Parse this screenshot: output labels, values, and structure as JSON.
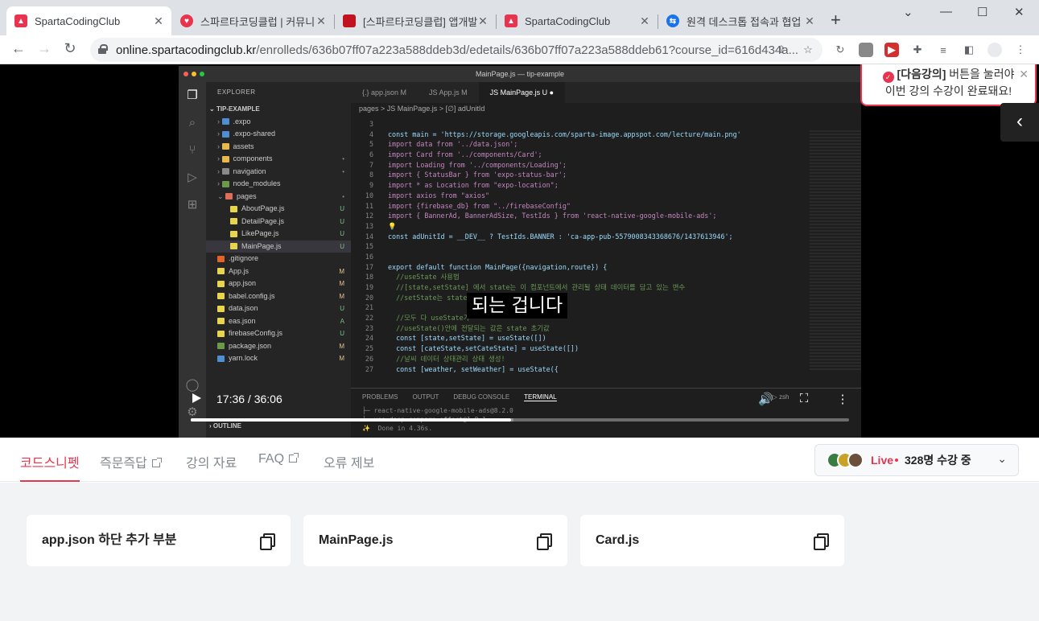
{
  "browser": {
    "tabs": [
      {
        "title": "SpartaCodingClub",
        "fav": "#e8344e"
      },
      {
        "title": "스파르타코딩클럽 | 커뮤니",
        "fav": "#e8344e"
      },
      {
        "title": "[스파르타코딩클럽] 앱개발",
        "fav": "#c1121f"
      },
      {
        "title": "SpartaCodingClub",
        "fav": "#e8344e"
      },
      {
        "title": "원격 데스크톱 접속과 협업",
        "fav": "#1a73e8"
      }
    ],
    "url_host": "online.spartacodingclub.kr",
    "url_path": "/enrolleds/636b07ff07a223a588ddeb3d/edetails/636b07ff07a223a588ddeb61?course_id=616d434a..."
  },
  "vscode": {
    "window_title": "MainPage.js — tip-example",
    "explorer_title": "EXPLORER",
    "project": "TIP-EXAMPLE",
    "files": [
      {
        "name": ".expo",
        "indent": 1,
        "color": "#4e8fd1",
        "status": ""
      },
      {
        "name": ".expo-shared",
        "indent": 1,
        "color": "#4e8fd1",
        "status": ""
      },
      {
        "name": "assets",
        "indent": 1,
        "color": "#e8b84a",
        "status": ""
      },
      {
        "name": "components",
        "indent": 1,
        "color": "#e8b84a",
        "status": "•"
      },
      {
        "name": "navigation",
        "indent": 1,
        "color": "#8a8a8a",
        "status": "•"
      },
      {
        "name": "node_modules",
        "indent": 1,
        "color": "#6a9a4a",
        "status": ""
      },
      {
        "name": "pages",
        "indent": 1,
        "color": "#e06c5a",
        "status": "•"
      },
      {
        "name": "AboutPage.js",
        "indent": 2,
        "color": "#e8d44d",
        "status": "U"
      },
      {
        "name": "DetailPage.js",
        "indent": 2,
        "color": "#e8d44d",
        "status": "U"
      },
      {
        "name": "LikePage.js",
        "indent": 2,
        "color": "#e8d44d",
        "status": "U"
      },
      {
        "name": "MainPage.js",
        "indent": 2,
        "color": "#e8d44d",
        "status": "U"
      },
      {
        "name": ".gitignore",
        "indent": 1,
        "color": "#e0642c",
        "status": ""
      },
      {
        "name": "App.js",
        "indent": 1,
        "color": "#e8d44d",
        "status": "M"
      },
      {
        "name": "app.json",
        "indent": 1,
        "color": "#e8d44d",
        "status": "M"
      },
      {
        "name": "babel.config.js",
        "indent": 1,
        "color": "#e8d44d",
        "status": "M"
      },
      {
        "name": "data.json",
        "indent": 1,
        "color": "#e8d44d",
        "status": "U"
      },
      {
        "name": "eas.json",
        "indent": 1,
        "color": "#e8d44d",
        "status": "A"
      },
      {
        "name": "firebaseConfig.js",
        "indent": 1,
        "color": "#e8d44d",
        "status": "U"
      },
      {
        "name": "package.json",
        "indent": 1,
        "color": "#6a9a4a",
        "status": "M"
      },
      {
        "name": "yarn.lock",
        "indent": 1,
        "color": "#4e8fd1",
        "status": "M"
      }
    ],
    "outline": "OUTLINE",
    "editor_tabs": [
      "{.} app.json M",
      "JS App.js M",
      "JS MainPage.js U ●"
    ],
    "breadcrumb": "pages  >  JS MainPage.js  >  [∅] adUnitId",
    "code": [
      {
        "n": "3",
        "t": ""
      },
      {
        "n": "4",
        "t": "const main = 'https://storage.googleapis.com/sparta-image.appspot.com/lecture/main.png'"
      },
      {
        "n": "5",
        "t": "import data from '../data.json';"
      },
      {
        "n": "6",
        "t": "import Card from '../components/Card';"
      },
      {
        "n": "7",
        "t": "import Loading from '../components/Loading';"
      },
      {
        "n": "8",
        "t": "import { StatusBar } from 'expo-status-bar';"
      },
      {
        "n": "9",
        "t": "import * as Location from \"expo-location\";"
      },
      {
        "n": "10",
        "t": "import axios from \"axios\""
      },
      {
        "n": "11",
        "t": "import {firebase_db} from \"../firebaseConfig\""
      },
      {
        "n": "12",
        "t": "import { BannerAd, BannerAdSize, TestIds } from 'react-native-google-mobile-ads';"
      },
      {
        "n": "13",
        "t": "💡"
      },
      {
        "n": "14",
        "t": "const adUnitId = __DEV__ ? TestIds.BANNER : 'ca-app-pub-5579008343368676/1437613946';"
      },
      {
        "n": "15",
        "t": ""
      },
      {
        "n": "16",
        "t": ""
      },
      {
        "n": "17",
        "t": "export default function MainPage({navigation,route}) {"
      },
      {
        "n": "18",
        "t": "  //useState 사용법"
      },
      {
        "n": "19",
        "t": "  //[state,setState] 에서 state는 이 컴포넌트에서 관리될 상태 데이터를 담고 있는 변수"
      },
      {
        "n": "20",
        "t": "  //setState는 state"
      },
      {
        "n": "21",
        "t": ""
      },
      {
        "n": "22",
        "t": "  //모두 다 useState가"
      },
      {
        "n": "23",
        "t": "  //useState()안에 전달되는 값은 state 초기값"
      },
      {
        "n": "24",
        "t": "  const [state,setState] = useState([])"
      },
      {
        "n": "25",
        "t": "  const [cateState,setCateState] = useState([])"
      },
      {
        "n": "26",
        "t": "  //날씨 데이터 상태관리 상태 생성!"
      },
      {
        "n": "27",
        "t": "  const [weather, setWeather] = useState({"
      }
    ],
    "panel_tabs": [
      "PROBLEMS",
      "OUTPUT",
      "DEBUG CONSOLE",
      "TERMINAL"
    ],
    "terminal_shell": "zsh",
    "terminal": [
      "├─ react-native-google-mobile-ads@8.2.0",
      "└─ use-deep-compare-effect@1.8.1",
      "✨  Done in 4.36s."
    ]
  },
  "player": {
    "subtitle": "되는 겁니다",
    "time": "17:36 / 36:06",
    "progress": 0.487,
    "buffered": 0.49
  },
  "toast": {
    "bold": "[다음강의]",
    "line1_rest": " 버튼을 눌러야",
    "line2": "이번 강의 수강이 완료돼요!"
  },
  "lower_tabs": [
    "코드스니펫",
    "즉문즉답",
    "강의 자료",
    "FAQ",
    "오류 제보"
  ],
  "live": {
    "label": "Live",
    "count": "328명 수강 중"
  },
  "snippets": [
    "app.json 하단 추가 부분",
    "MainPage.js",
    "Card.js"
  ],
  "colors": {
    "accent": "#e8344e"
  }
}
